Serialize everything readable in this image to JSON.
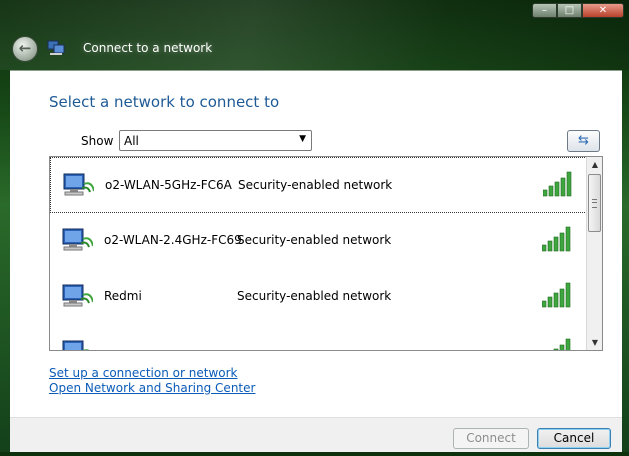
{
  "window": {
    "title": "Connect to a network",
    "caption": {
      "minimize": "–",
      "maximize": "□",
      "close": "✕"
    }
  },
  "heading": "Select a network to connect to",
  "filter": {
    "label": "Show",
    "selected": "All"
  },
  "networks": [
    {
      "name": "o2-WLAN-5GHz-FC6A",
      "status": "Security-enabled network",
      "selected": true
    },
    {
      "name": "o2-WLAN-2.4GHz-FC69",
      "status": "Security-enabled network",
      "selected": false
    },
    {
      "name": "Redmi",
      "status": "Security-enabled network",
      "selected": false
    }
  ],
  "links": {
    "setup": "Set up a connection or network",
    "sharing_center": "Open Network and Sharing Center"
  },
  "buttons": {
    "connect": "Connect",
    "cancel": "Cancel"
  },
  "colors": {
    "heading": "#1e5a96",
    "link": "#0b5bb8",
    "signal": "#3fa63f"
  }
}
